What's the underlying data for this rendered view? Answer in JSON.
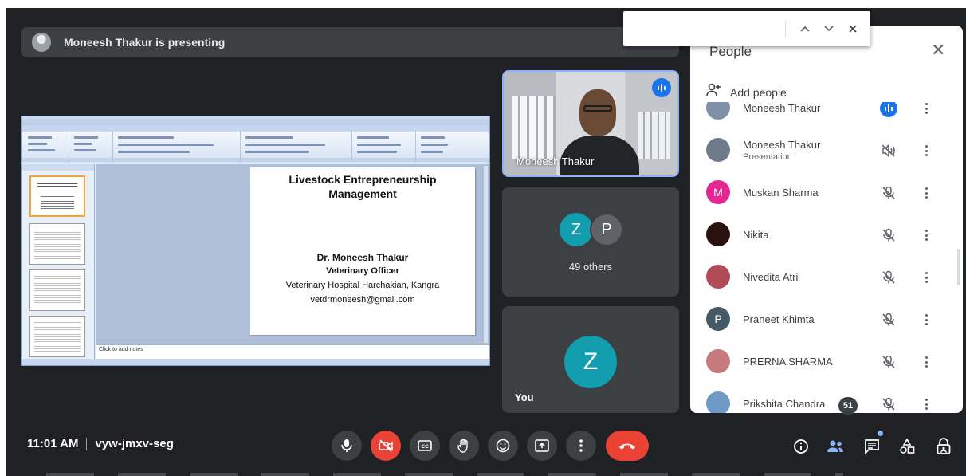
{
  "presenter": {
    "text": "Moneesh Thakur is presenting"
  },
  "find_bar": {
    "up": "⌃",
    "down": "⌄",
    "close": "✕"
  },
  "slide": {
    "title_line1": "Livestock Entrepreneurship",
    "title_line2": "Management",
    "name": "Dr. Moneesh Thakur",
    "role": "Veterinary Officer",
    "place": "Veterinary Hospital Harchakian, Kangra",
    "email": "vetdrmoneesh@gmail.com",
    "notes_placeholder": "Click to add notes"
  },
  "tiles": {
    "presenter_name": "Moneesh Thakur",
    "others_initials": [
      "Z",
      "P"
    ],
    "others_count_text": "49 others",
    "you_initial": "Z",
    "you_label": "You"
  },
  "people_panel": {
    "title": "People",
    "add_people_label": "Add people",
    "participants": [
      {
        "name": "Moneesh Thakur",
        "subtitle": "",
        "mic": "speaking",
        "avatar_color": "#7e8fa6",
        "initial": ""
      },
      {
        "name": "Moneesh Thakur",
        "subtitle": "Presentation",
        "mic": "presenting",
        "avatar_color": "#6c7a89",
        "initial": ""
      },
      {
        "name": "Muskan Sharma",
        "subtitle": "",
        "mic": "muted",
        "avatar_color": "#e52592",
        "initial": "M"
      },
      {
        "name": "Nikita",
        "subtitle": "",
        "mic": "muted",
        "avatar_color": "#2b1010",
        "initial": ""
      },
      {
        "name": "Nivedita Atri",
        "subtitle": "",
        "mic": "muted",
        "avatar_color": "#b34a57",
        "initial": ""
      },
      {
        "name": "Praneet Khimta",
        "subtitle": "",
        "mic": "muted",
        "avatar_color": "#455a64",
        "initial": "P"
      },
      {
        "name": "PRERNA SHARMA",
        "subtitle": "",
        "mic": "muted",
        "avatar_color": "#c57b7b",
        "initial": ""
      },
      {
        "name": "Prikshita Chandra",
        "subtitle": "",
        "mic": "muted",
        "avatar_color": "#6f9ac7",
        "initial": ""
      }
    ]
  },
  "bottom_bar": {
    "time": "11:01 AM",
    "meeting_code": "vyw-jmxv-seg",
    "participant_count": "51"
  },
  "colors": {
    "bg": "#202124",
    "tile": "#3c4043",
    "accent_blue": "#1a73e8",
    "red": "#ea4335",
    "teal": "#129eaf"
  }
}
